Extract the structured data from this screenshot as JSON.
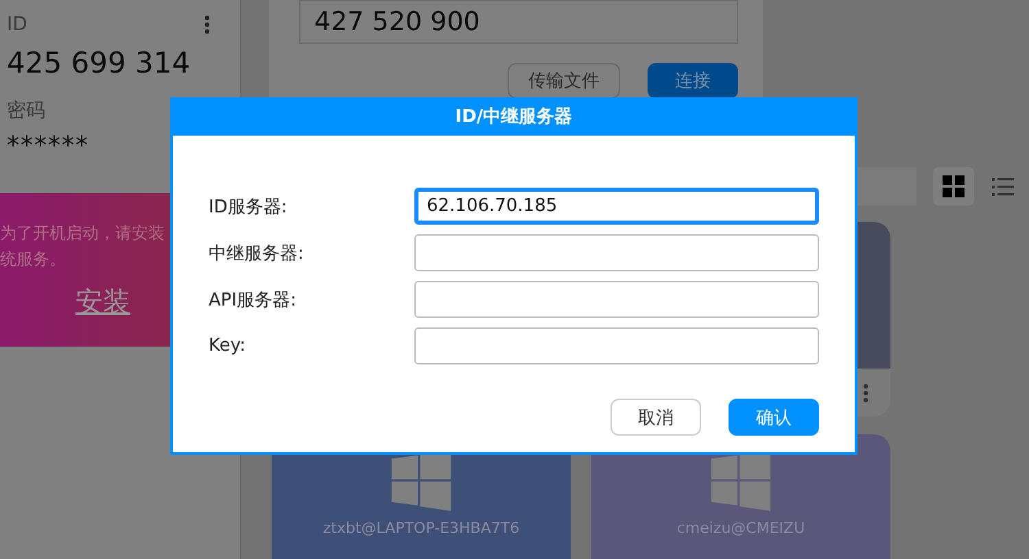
{
  "sidebar": {
    "id_label": "ID",
    "id_value": "425 699 314",
    "password_label": "密码",
    "password_value": "******",
    "install_banner": {
      "lines": [
        "为了开机启动，请安装",
        "统服务。"
      ],
      "button": "安装"
    }
  },
  "connect_card": {
    "remote_id": "427 520 900",
    "buttons": [
      {
        "label": "传输文件",
        "kind": "secondary"
      },
      {
        "label": "连接",
        "kind": "primary"
      }
    ]
  },
  "view_toggle": [
    {
      "kind": "grid",
      "selected": true
    },
    {
      "kind": "list",
      "selected": false
    }
  ],
  "peers": [
    {
      "kind": "blank",
      "color": "#474b5c"
    },
    {
      "kind": "windows",
      "name": "ztxbt@LAPTOP-E3HBA7T6",
      "color": "#3f5078"
    },
    {
      "kind": "windows",
      "name": "cmeizu@CMEIZU",
      "color": "#5a577b"
    }
  ],
  "dialog": {
    "title": "ID/中继服务器",
    "fields": [
      {
        "label": "ID服务器:",
        "value": "62.106.70.185",
        "focused": true
      },
      {
        "label": "中继服务器:",
        "focused": false
      },
      {
        "label": "API服务器:",
        "focused": false
      },
      {
        "label": "Key:",
        "focused": false
      }
    ],
    "buttons": [
      {
        "label": "取消",
        "kind": "secondary"
      },
      {
        "label": "确认",
        "kind": "primary"
      }
    ]
  }
}
